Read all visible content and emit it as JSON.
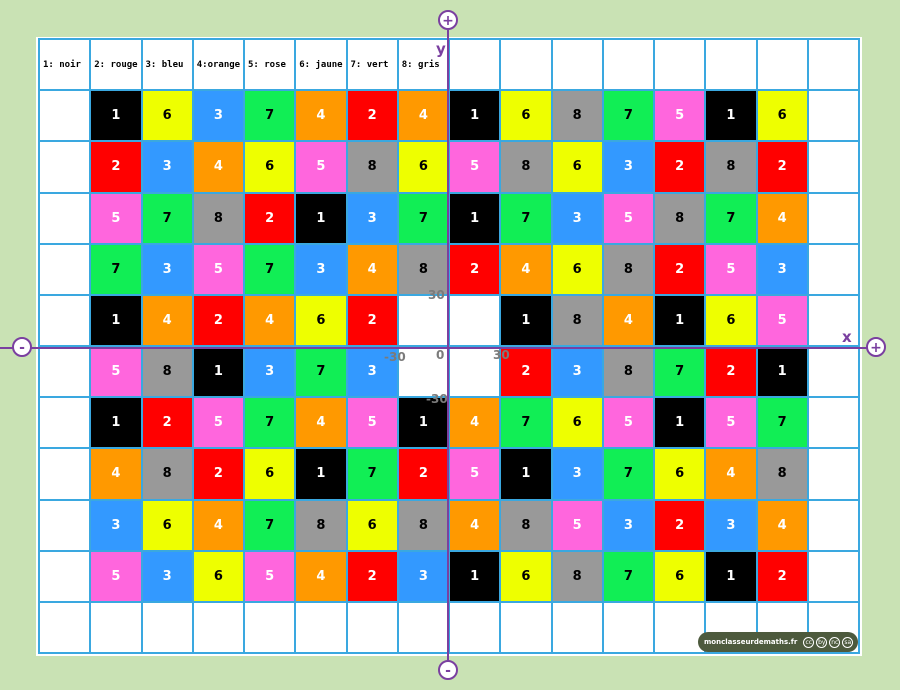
{
  "legend": [
    "1: noir",
    "2: rouge",
    "3: bleu",
    "4:orange",
    "5: rose",
    "6: jaune",
    "7: vert",
    "8: gris"
  ],
  "colors": {
    "1": "#000000",
    "2": "#ff0000",
    "3": "#3399ff",
    "4": "#ff9900",
    "5": "#ff66dd",
    "6": "#eeff00",
    "7": "#11ee55",
    "8": "#999999"
  },
  "rows": [
    [
      0,
      1,
      6,
      3,
      7,
      4,
      2,
      4,
      1,
      6,
      8,
      7,
      5,
      1,
      6,
      0
    ],
    [
      0,
      2,
      3,
      4,
      6,
      5,
      8,
      6,
      5,
      8,
      6,
      3,
      2,
      8,
      2,
      0
    ],
    [
      0,
      5,
      7,
      8,
      2,
      1,
      3,
      7,
      1,
      7,
      3,
      5,
      8,
      7,
      4,
      0
    ],
    [
      0,
      7,
      3,
      5,
      7,
      3,
      4,
      8,
      2,
      4,
      6,
      8,
      2,
      5,
      3,
      0
    ],
    [
      0,
      1,
      4,
      2,
      4,
      6,
      2,
      0,
      0,
      1,
      8,
      4,
      1,
      6,
      5,
      0
    ],
    [
      0,
      5,
      8,
      1,
      3,
      7,
      3,
      0,
      0,
      2,
      3,
      8,
      7,
      2,
      1,
      0
    ],
    [
      0,
      1,
      2,
      5,
      7,
      4,
      5,
      1,
      4,
      7,
      6,
      5,
      1,
      5,
      7,
      0
    ],
    [
      0,
      4,
      8,
      2,
      6,
      1,
      7,
      2,
      5,
      1,
      3,
      7,
      6,
      4,
      8,
      0
    ],
    [
      0,
      3,
      6,
      4,
      7,
      8,
      6,
      8,
      4,
      8,
      5,
      3,
      2,
      3,
      4,
      0
    ],
    [
      0,
      5,
      3,
      6,
      5,
      4,
      2,
      3,
      1,
      6,
      8,
      7,
      6,
      1,
      2,
      0
    ]
  ],
  "axes": {
    "x_label": "x",
    "y_label": "y",
    "origin": "0",
    "tick_pos_x": "30",
    "tick_neg_x": "-30",
    "tick_pos_y": "30",
    "tick_neg_y": "-30"
  },
  "zoom": {
    "plus": "+",
    "minus": "-"
  },
  "badge": {
    "site": "monclasseurdemaths.fr",
    "license_icons": [
      "cc",
      "by",
      "nc",
      "sa"
    ]
  }
}
